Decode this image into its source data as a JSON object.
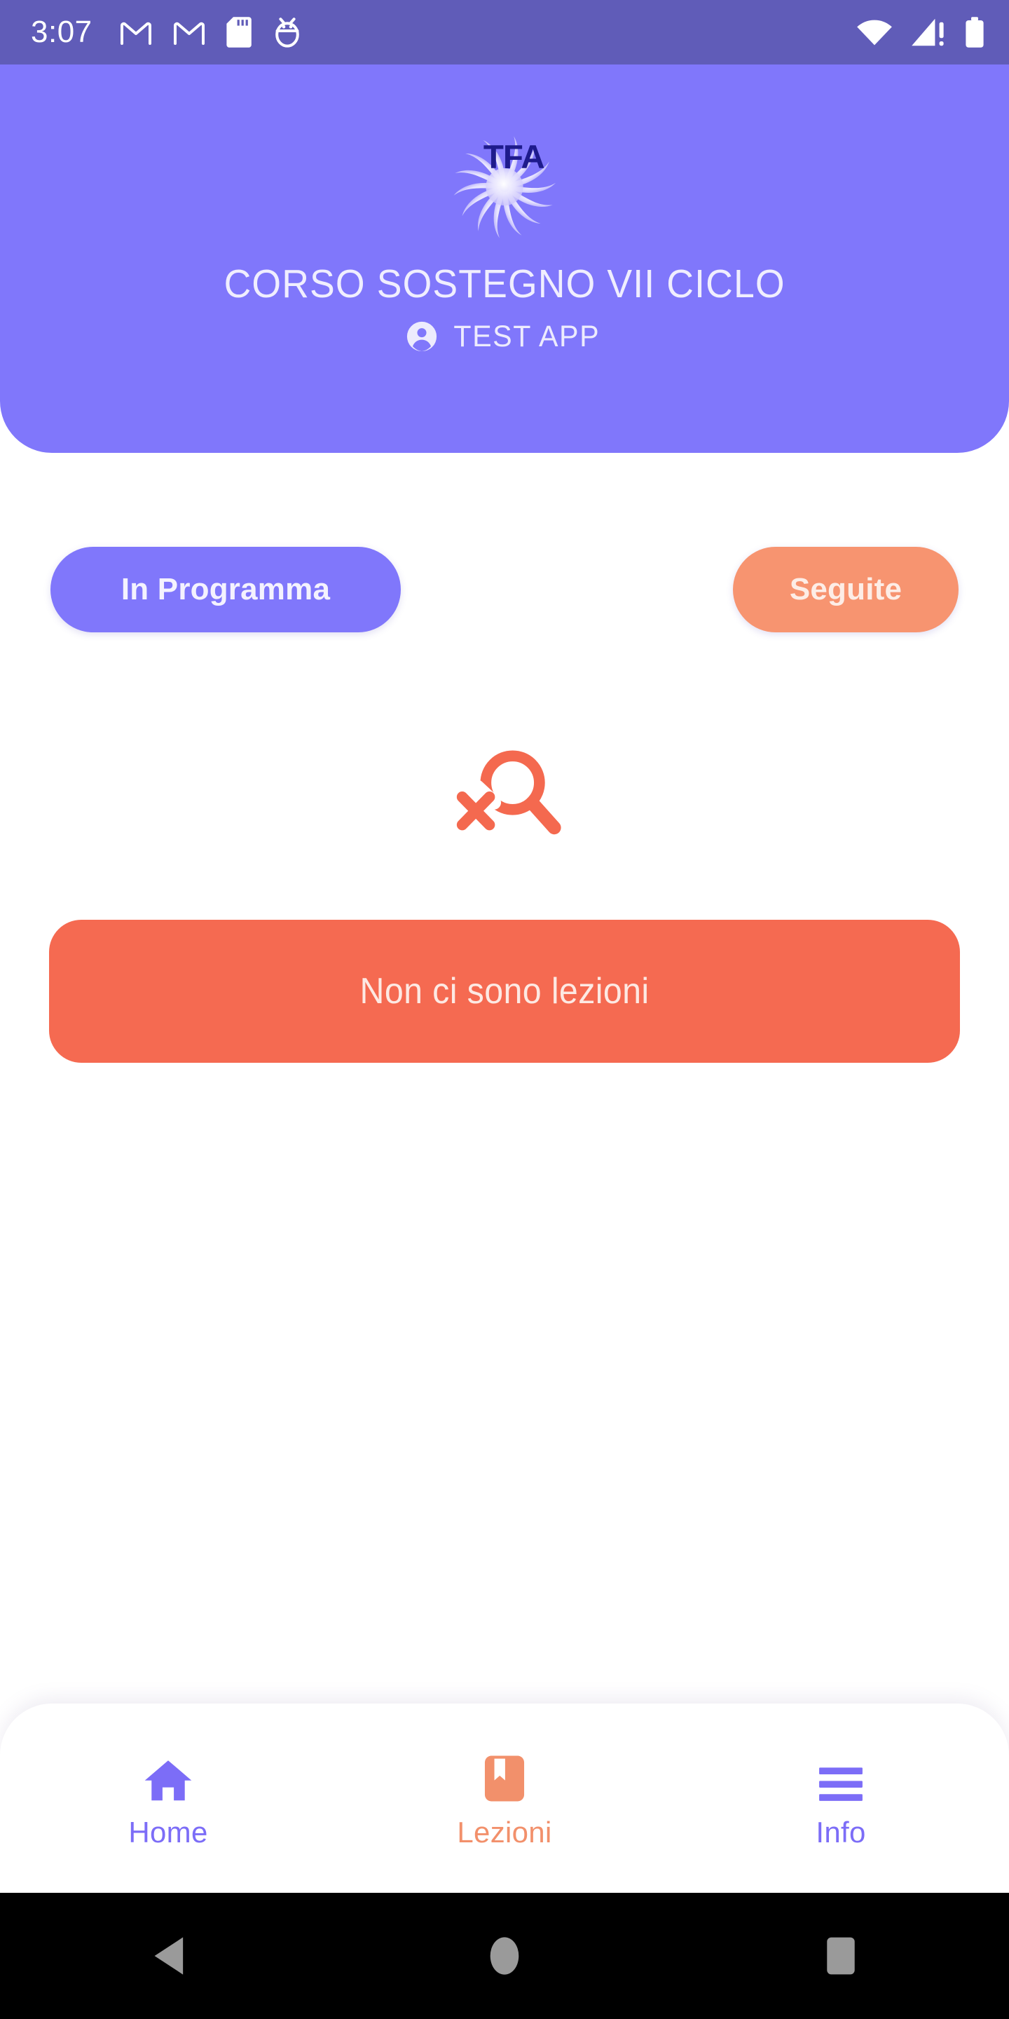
{
  "status_bar": {
    "time": "3:07",
    "left_icons": [
      "gmail-icon",
      "gmail-icon",
      "sd-card-icon",
      "android-debug-icon"
    ],
    "right_icons": [
      "wifi-icon",
      "cellular-signal-warning-icon",
      "battery-icon"
    ],
    "background_color": "#605CB8"
  },
  "header": {
    "logo_name": "tfa-sun-logo",
    "logo_text": "TFA",
    "title": "CORSO SOSTEGNO VII CICLO",
    "user_icon": "account-circle-icon",
    "user_label": "TEST APP",
    "background_color": "#8077FB",
    "title_color": "#F0EEFE"
  },
  "filters": {
    "in_programma": {
      "label": "In Programma",
      "color": "#8077FB",
      "text_color": "#F4F2FE",
      "selected": true
    },
    "seguite": {
      "label": "Seguite",
      "color": "#F79470",
      "text_color": "#FDEDE6",
      "selected": false
    }
  },
  "empty_state": {
    "icon_name": "search-not-found-icon",
    "icon_color": "#F4694F",
    "message": "Non ci sono lezioni",
    "banner_color": "#F56A51",
    "message_color": "#FDE9E3"
  },
  "bottom_nav": {
    "items": [
      {
        "label": "Home",
        "icon": "home-icon",
        "color": "#7C6DF7",
        "active": false
      },
      {
        "label": "Lezioni",
        "icon": "bookmark-book-icon",
        "color": "#F2906B",
        "active": true
      },
      {
        "label": "Info",
        "icon": "hamburger-menu-icon",
        "color": "#7C6DF7",
        "active": false
      }
    ]
  },
  "android_nav": {
    "back": "back-triangle-icon",
    "home": "home-circle-icon",
    "recents": "recents-square-icon",
    "icon_color": "#9A9A9A",
    "background_color": "#000000"
  }
}
